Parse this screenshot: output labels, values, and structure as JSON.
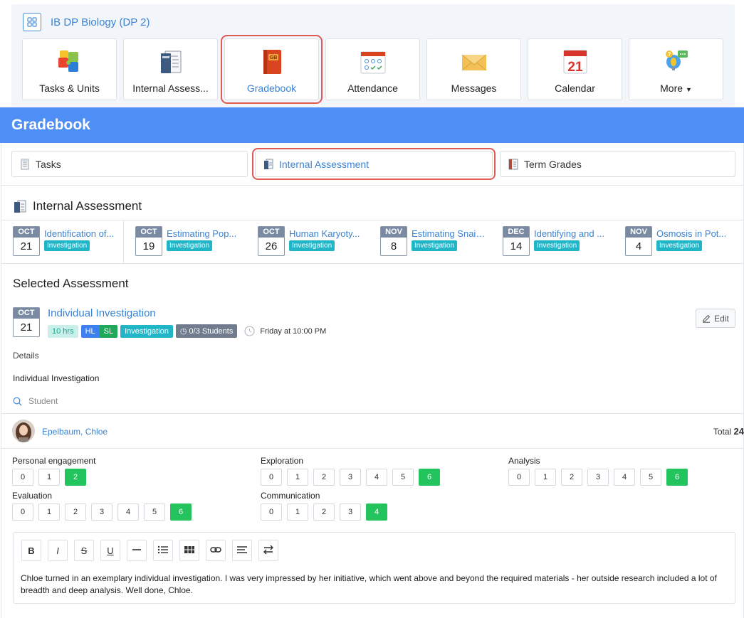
{
  "course": {
    "title": "IB DP Biology (DP 2)",
    "icon": "grid-icon"
  },
  "apps": [
    {
      "label": "Tasks & Units",
      "icon": "puzzle-icon"
    },
    {
      "label": "Internal Assess...",
      "icon": "report-icon"
    },
    {
      "label": "Gradebook",
      "icon": "gradebook-icon"
    },
    {
      "label": "Attendance",
      "icon": "attendance-icon"
    },
    {
      "label": "Messages",
      "icon": "envelope-icon"
    },
    {
      "label": "Calendar",
      "icon": "calendar-icon",
      "calendar_day": "21",
      "calendar_header": "Calendar"
    },
    {
      "label": "More",
      "icon": "more-icon"
    }
  ],
  "gradebook": {
    "title": "Gradebook"
  },
  "tabs": [
    {
      "label": "Tasks",
      "icon": "notepad-icon"
    },
    {
      "label": "Internal Assessment",
      "icon": "report-icon"
    },
    {
      "label": "Term Grades",
      "icon": "grades-icon"
    }
  ],
  "ia_heading": "Internal Assessment",
  "assessments": [
    {
      "month": "OCT",
      "day": "21",
      "title": "Identification of...",
      "tag": "Investigation"
    },
    {
      "month": "OCT",
      "day": "19",
      "title": "Estimating Pop...",
      "tag": "Investigation"
    },
    {
      "month": "OCT",
      "day": "26",
      "title": "Human Karyoty...",
      "tag": "Investigation"
    },
    {
      "month": "NOV",
      "day": "8",
      "title": "Estimating Snail...",
      "tag": "Investigation"
    },
    {
      "month": "DEC",
      "day": "14",
      "title": "Identifying and ...",
      "tag": "Investigation"
    },
    {
      "month": "NOV",
      "day": "4",
      "title": "Osmosis in Pot...",
      "tag": "Investigation"
    }
  ],
  "selected": {
    "heading": "Selected Assessment",
    "month": "OCT",
    "day": "21",
    "title": "Individual Investigation",
    "hours": "10 hrs",
    "level_hl": "HL",
    "level_sl": "SL",
    "type": "Investigation",
    "students": "0/3 Students",
    "due": "Friday at 10:00 PM",
    "edit_label": "Edit",
    "details_label": "Details",
    "details_text": "Individual Investigation",
    "search_placeholder": "Student"
  },
  "student": {
    "name": "Epelbaum, Chloe",
    "total_label": "Total",
    "total_value": "24",
    "criteria": [
      {
        "name": "Personal engagement",
        "options": [
          "0",
          "1",
          "2"
        ],
        "selected": 2
      },
      {
        "name": "Exploration",
        "options": [
          "0",
          "1",
          "2",
          "3",
          "4",
          "5",
          "6"
        ],
        "selected": 6
      },
      {
        "name": "Analysis",
        "options": [
          "0",
          "1",
          "2",
          "3",
          "4",
          "5",
          "6"
        ],
        "selected": 6
      },
      {
        "name": "Evaluation",
        "options": [
          "0",
          "1",
          "2",
          "3",
          "4",
          "5",
          "6"
        ],
        "selected": 6
      },
      {
        "name": "Communication",
        "options": [
          "0",
          "1",
          "2",
          "3",
          "4"
        ],
        "selected": 4
      }
    ],
    "comment": "Chloe turned in an exemplary individual investigation. I was very impressed by her initiative, which went above and beyond the required materials - her outside research included a lot of breadth and deep analysis. Well done, Chloe."
  },
  "editor_toolbar": [
    "bold",
    "italic",
    "strikethrough",
    "underline",
    "horizontal-rule",
    "bullet-list",
    "table",
    "link",
    "align",
    "direction"
  ],
  "colors": {
    "accent": "#4f8ff5",
    "link": "#3a83d6",
    "selected_score": "#23c45e",
    "highlight": "#e05a52",
    "tag": "#22b5c8"
  }
}
